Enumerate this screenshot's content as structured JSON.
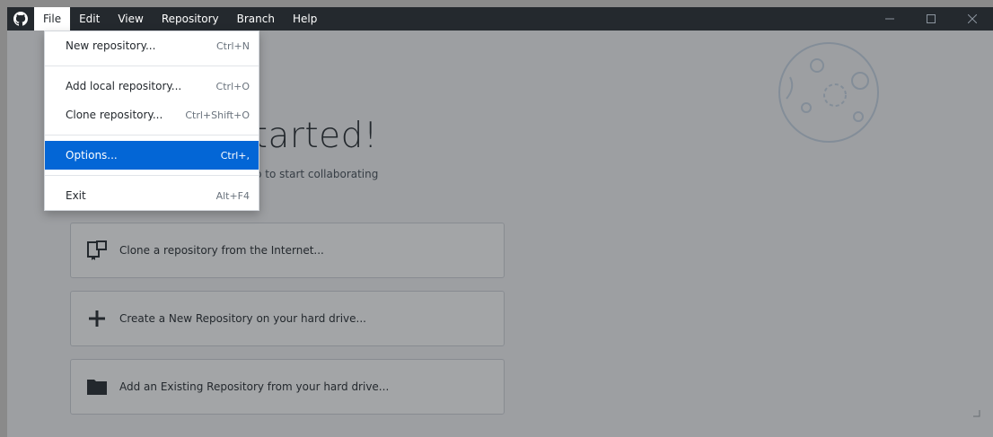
{
  "menubar": {
    "items": [
      {
        "label": "File"
      },
      {
        "label": "Edit"
      },
      {
        "label": "View"
      },
      {
        "label": "Repository"
      },
      {
        "label": "Branch"
      },
      {
        "label": "Help"
      }
    ]
  },
  "welcome": {
    "headline": "Let's get started!",
    "subheadline": "Add a repository to GitHub Desktop to start collaborating"
  },
  "actions": [
    {
      "label": "Clone a repository from the Internet..."
    },
    {
      "label": "Create a New Repository on your hard drive..."
    },
    {
      "label": "Add an Existing Repository from your hard drive..."
    }
  ],
  "file_menu": {
    "items": [
      {
        "label": "New repository...",
        "accel": "Ctrl+N"
      },
      {
        "label": "Add local repository...",
        "accel": "Ctrl+O"
      },
      {
        "label": "Clone repository...",
        "accel": "Ctrl+Shift+O"
      },
      {
        "label": "Options...",
        "accel": "Ctrl+,"
      },
      {
        "label": "Exit",
        "accel": "Alt+F4"
      }
    ],
    "selected": "Options..."
  },
  "colors": {
    "titlebar": "#24292e",
    "highlight": "#0366d6",
    "background": "#f4f5f6"
  },
  "icons": [
    "github-logo-icon",
    "minimize-icon",
    "maximize-icon",
    "close-icon",
    "moon-illustration-icon",
    "clone-desktop-icon",
    "plus-icon",
    "folder-icon"
  ]
}
